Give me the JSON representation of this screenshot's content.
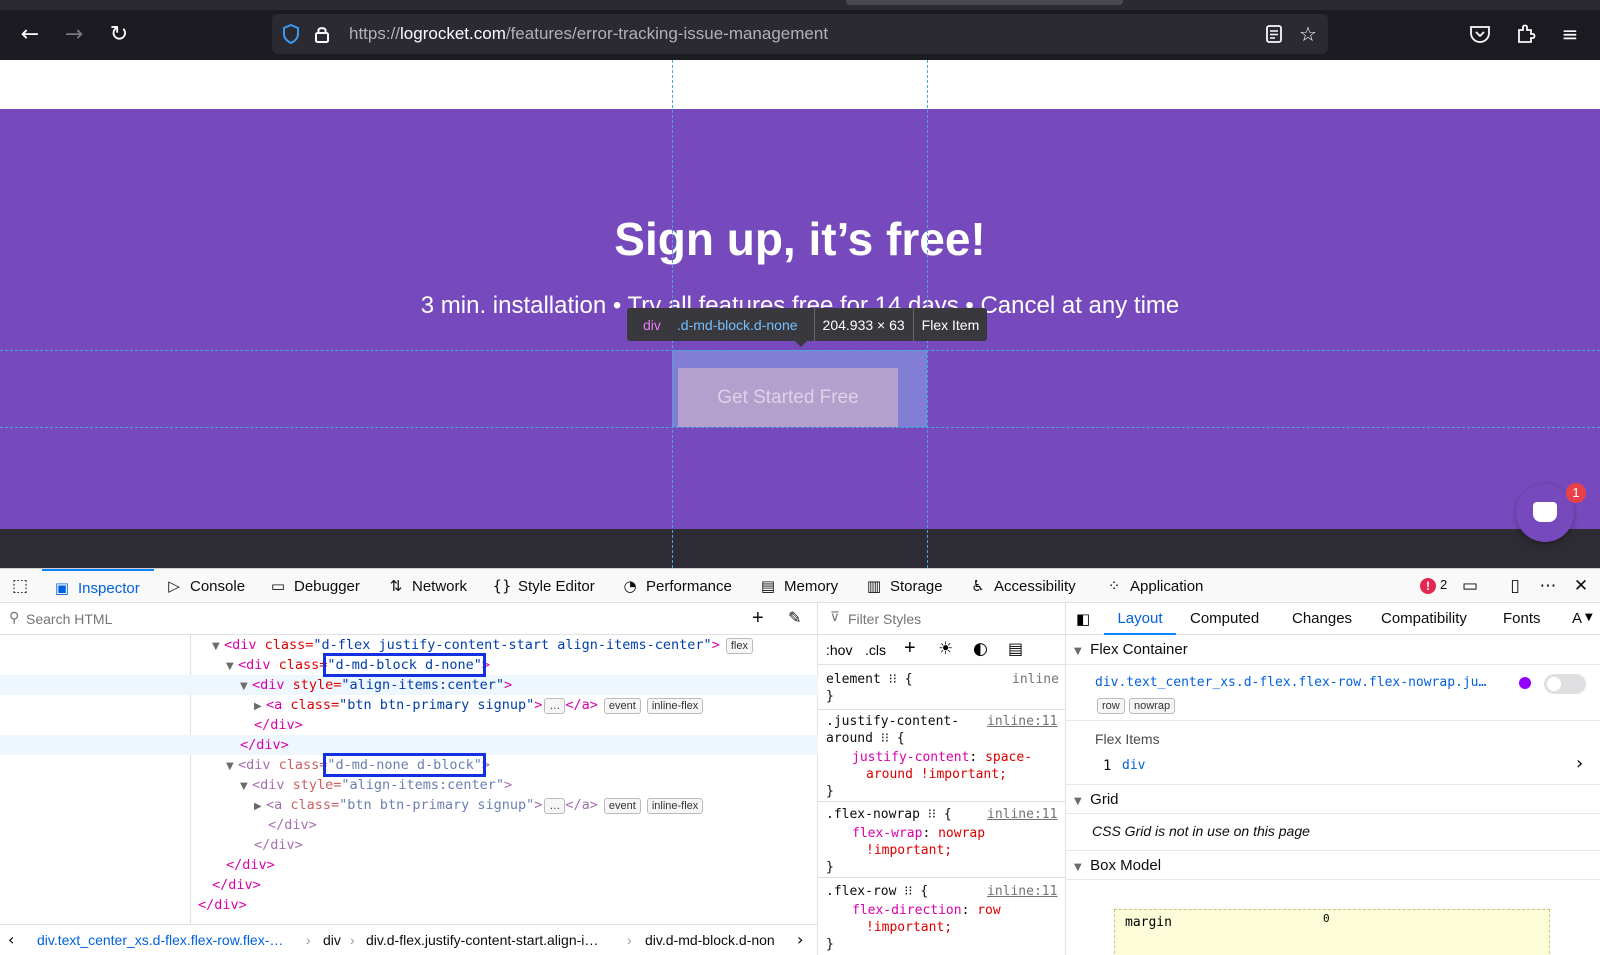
{
  "browser": {
    "url_prefix": "https://",
    "url_host": "logrocket.com",
    "url_path": "/features/error-tracking-issue-management",
    "icons": [
      "back-arrow-icon",
      "forward-arrow-icon",
      "reload-icon",
      "shield-icon",
      "lock-icon",
      "reader-view-icon",
      "star-icon",
      "pocket-icon",
      "extensions-icon",
      "menu-icon"
    ]
  },
  "page": {
    "headline": "Sign up, it’s free!",
    "subline": "3 min. installation • Try all features free for 14 days • Cancel at any time",
    "cta_label": "Get Started Free",
    "chat_badge": "1",
    "colors": {
      "purple": "#764abc",
      "highlight": "#8caaeb",
      "guide": "#4aa6d9"
    }
  },
  "tooltip": {
    "tag": "div",
    "classes": ".d-md-block.d-none",
    "size": "204.933 × 63",
    "kind": "Flex Item"
  },
  "devtools": {
    "tabs": [
      "Inspector",
      "Console",
      "Debugger",
      "Network",
      "Style Editor",
      "Performance",
      "Memory",
      "Storage",
      "Accessibility",
      "Application"
    ],
    "error_count": "2",
    "search_placeholder": "Search HTML",
    "filter_placeholder": "Filter Styles",
    "markup": {
      "l0": {
        "tag": "<div",
        "attr": " class=",
        "val": "\"d-flex justify-content-start align-items-center\"",
        "end": ">",
        "pill": "flex"
      },
      "l1": {
        "tag": "<div",
        "attr": " class=",
        "val": "\"d-md-block d-none\"",
        "end": ">"
      },
      "l2": {
        "tag": "<div",
        "attr": " style=",
        "val": "\"align-items:center\"",
        "end": ">"
      },
      "l3": {
        "tag": "<a",
        "attr": " class=",
        "val": "\"btn btn-primary signup\"",
        "end": ">",
        "dots": "…",
        "close": "</a>",
        "pill1": "event",
        "pill2": "inline-flex"
      },
      "l4": "</div>",
      "l5": "</div>",
      "l6": {
        "tag": "<div",
        "attr": " class=",
        "val": "\"d-md-none d-block\"",
        "end": ">"
      },
      "l7": {
        "tag": "<div",
        "attr": " style=",
        "val": "\"align-items:center\"",
        "end": ">"
      },
      "l8": {
        "tag": "<a",
        "attr": " class=",
        "val": "\"btn btn-primary signup\"",
        "end": ">",
        "dots": "…",
        "close": "</a>",
        "pill1": "event",
        "pill2": "inline-flex"
      },
      "l9": "</div>",
      "l10": "</div>",
      "l11": "</div>",
      "l12": "</div>",
      "l13": "</div>"
    },
    "breadcrumbs": [
      "div.text_center_xs.d-flex.flex-row.flex-…",
      "div",
      "div.d-flex.justify-content-start.align-i…",
      "div.d-md-block.d-non"
    ],
    "rules_toolbar": {
      "hov": ":hov",
      "cls": ".cls"
    },
    "rules": {
      "r0": {
        "sel": "element",
        "src": "inline"
      },
      "r1": {
        "sel": ".justify-content-",
        "sel2": "around",
        "src": "inline:11",
        "prop": "justify-content",
        "val": "space-",
        "val2": "around !important;"
      },
      "r2": {
        "sel": ".flex-nowrap",
        "src": "inline:11",
        "prop": "flex-wrap",
        "val": "nowrap",
        "val2": "!important;"
      },
      "r3": {
        "sel": ".flex-row",
        "src": "inline:11",
        "prop": "flex-direction",
        "val": "row",
        "val2": "!important;"
      }
    },
    "layout_tabs": [
      "Layout",
      "Computed",
      "Changes",
      "Compatibility",
      "Fonts",
      "A"
    ],
    "layout": {
      "flex_container": "Flex Container",
      "container_sel": "div.text_center_xs.d-flex.flex-row.flex-nowrap.ju…",
      "badge_row": "row",
      "badge_nowrap": "nowrap",
      "flex_items": "Flex Items",
      "item_index": "1",
      "item_tag": "div",
      "grid": "Grid",
      "grid_msg": "CSS Grid is not in use on this page",
      "box_model": "Box Model",
      "margin_label": "margin",
      "margin_value": "0"
    }
  }
}
